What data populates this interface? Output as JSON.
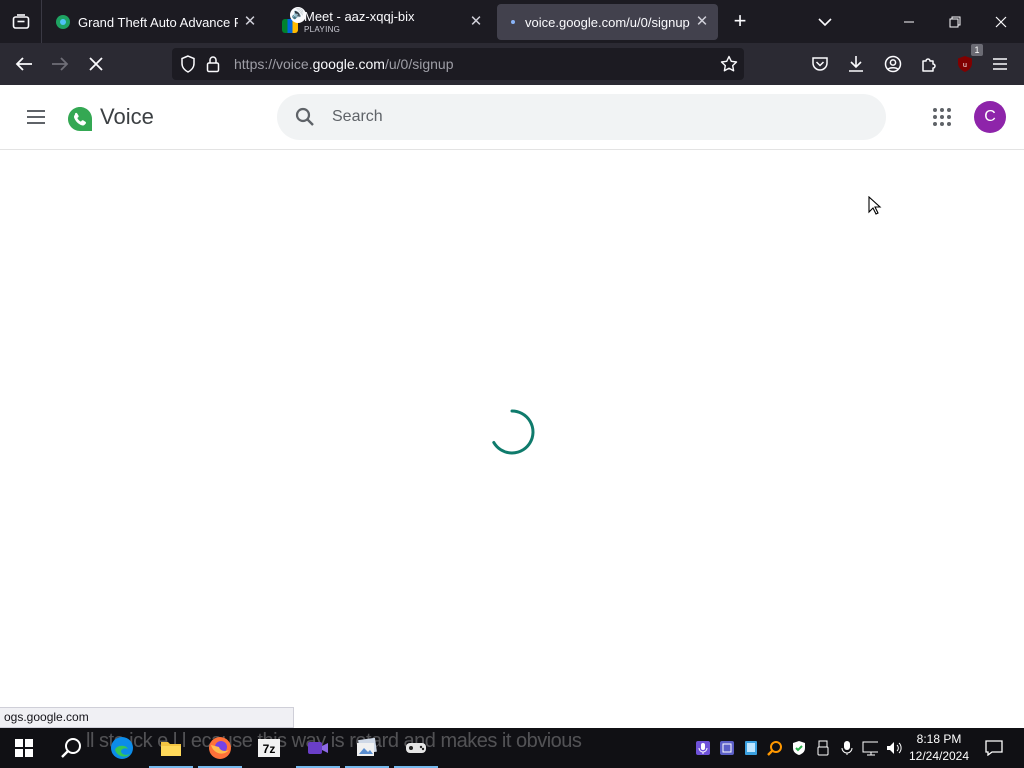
{
  "browser": {
    "tabs": [
      {
        "title": "Grand Theft Auto Advance ROM",
        "active": false
      },
      {
        "title": "Meet - aaz-xqqj-bix",
        "subtitle": "PLAYING",
        "active": false
      },
      {
        "title": "voice.google.com/u/0/signup",
        "active": true
      }
    ],
    "url_prefix": "https://voice.",
    "url_host": "google.com",
    "url_path": "/u/0/signup",
    "extension_badge": "1"
  },
  "app": {
    "name": "Voice",
    "search_placeholder": "Search",
    "avatar_initial": "C"
  },
  "status_text": "ogs.google.com",
  "taskbar": {
    "overlay_caption": "ll sto  ick   e  l    l  ecause  this way is  retard and makes it obvious",
    "time": "8:18 PM",
    "date": "12/24/2024"
  },
  "colors": {
    "accent_spinner": "#0f7b6c",
    "avatar_bg": "#8e24aa",
    "voice_green": "#34a853"
  }
}
